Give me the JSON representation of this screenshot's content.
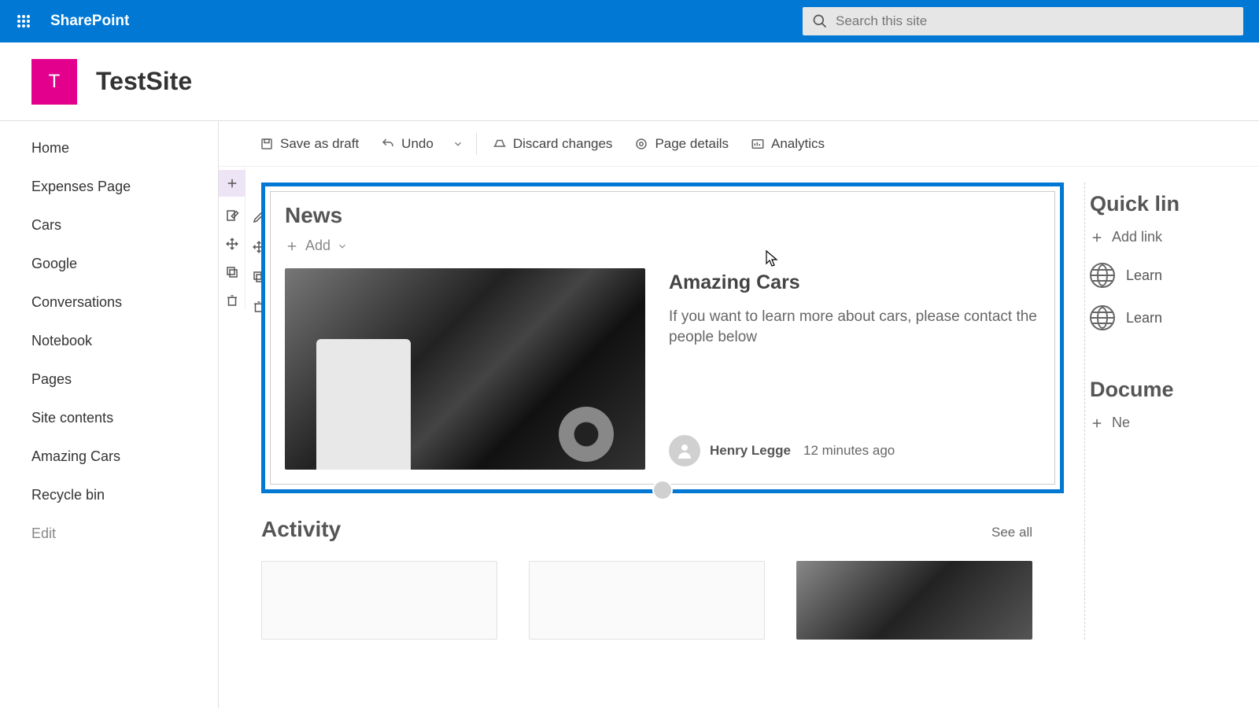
{
  "header": {
    "brand": "SharePoint",
    "search_placeholder": "Search this site"
  },
  "site": {
    "logo_letter": "T",
    "title": "TestSite"
  },
  "nav": {
    "items": [
      "Home",
      "Expenses Page",
      "Cars",
      "Google",
      "Conversations",
      "Notebook",
      "Pages",
      "Site contents",
      "Amazing Cars",
      "Recycle bin"
    ],
    "edit": "Edit"
  },
  "commands": {
    "save": "Save as draft",
    "undo": "Undo",
    "discard": "Discard changes",
    "details": "Page details",
    "analytics": "Analytics"
  },
  "news": {
    "heading": "News",
    "add": "Add",
    "article": {
      "title": "Amazing Cars",
      "desc": "If you want to learn more about cars, please contact the people below",
      "author": "Henry Legge",
      "time": "12 minutes ago"
    }
  },
  "activity": {
    "heading": "Activity",
    "see_all": "See all"
  },
  "right": {
    "quicklinks_title": "Quick lin",
    "add_link": "Add link",
    "link1": "Learn",
    "link2": "Learn",
    "documents_title": "Docume",
    "new": "Ne"
  }
}
